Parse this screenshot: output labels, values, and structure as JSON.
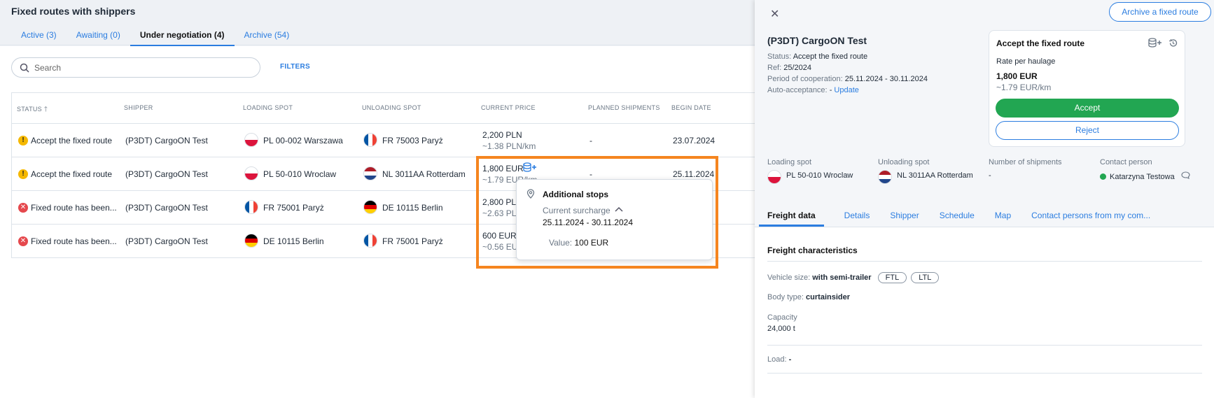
{
  "header": {
    "title": "Fixed routes with shippers",
    "tabs": [
      {
        "label": "Active (3)"
      },
      {
        "label": "Awaiting (0)"
      },
      {
        "label": "Under negotiation (4)"
      },
      {
        "label": "Archive (54)"
      }
    ]
  },
  "toolbar": {
    "search_placeholder": "Search",
    "filters_label": "FILTERS"
  },
  "table": {
    "columns": [
      "STATUS",
      "SHIPPER",
      "LOADING SPOT",
      "UNLOADING SPOT",
      "CURRENT PRICE",
      "PLANNED SHIPMENTS",
      "BEGIN DATE"
    ],
    "rows": [
      {
        "status": "Accept the fixed route",
        "status_type": "warning",
        "shipper": "(P3DT) CargoON Test",
        "loading": "PL 00-002 Warszawa",
        "loading_flag": "PL",
        "unloading": "FR 75003 Paryż",
        "unloading_flag": "FR",
        "price": "2,200 PLN",
        "price_km": "~1.38 PLN/km",
        "planned": "-",
        "begin": "23.07.2024"
      },
      {
        "status": "Accept the fixed route",
        "status_type": "warning",
        "shipper": "(P3DT) CargoON Test",
        "loading": "PL 50-010 Wroclaw",
        "loading_flag": "PL",
        "unloading": "NL 3011AA Rotterdam",
        "unloading_flag": "NL",
        "price": "1,800 EUR",
        "price_km": "~1.79 EUR/km",
        "planned": "-",
        "begin": "25.11.2024"
      },
      {
        "status": "Fixed route has been...",
        "status_type": "error",
        "shipper": "(P3DT) CargoON Test",
        "loading": "FR 75001 Paryż",
        "loading_flag": "FR",
        "unloading": "DE 10115 Berlin",
        "unloading_flag": "DE",
        "price": "2,800 PLN",
        "price_km": "~2.63 PLN/km",
        "planned": "",
        "begin": ""
      },
      {
        "status": "Fixed route has been...",
        "status_type": "error",
        "shipper": "(P3DT) CargoON Test",
        "loading": "DE 10115 Berlin",
        "loading_flag": "DE",
        "unloading": "FR 75001 Paryż",
        "unloading_flag": "FR",
        "price": "600 EUR",
        "price_km": "~0.56 EUR/km",
        "planned": "",
        "begin": ""
      }
    ]
  },
  "popup": {
    "title": "Additional stops",
    "surcharge_label": "Current surcharge",
    "dates": "25.11.2024 - 30.11.2024",
    "value_label": "Value:",
    "value": "100 EUR"
  },
  "detail": {
    "archive_button": "Archive a fixed route",
    "title": "(P3DT) CargoON Test",
    "status_label": "Status:",
    "status_value": "Accept the fixed route",
    "ref_label": "Ref:",
    "ref_value": "25/2024",
    "period_label": "Period of cooperation:",
    "period_value": "25.11.2024 - 30.11.2024",
    "auto_label": "Auto-acceptance:",
    "auto_value": "-",
    "auto_link": "Update",
    "accept_card": {
      "title": "Accept the fixed route",
      "rate_label": "Rate per haulage",
      "price": "1,800 EUR",
      "price_km": "~1.79 EUR/km",
      "accept_label": "Accept",
      "reject_label": "Reject"
    },
    "spots": {
      "loading_label": "Loading spot",
      "loading_value": "PL 50-010 Wroclaw",
      "unloading_label": "Unloading spot",
      "unloading_value": "NL 3011AA Rotterdam",
      "shipments_label": "Number of shipments",
      "shipments_value": "-",
      "contact_label": "Contact person",
      "contact_value": "Katarzyna Testowa"
    },
    "tabs": [
      {
        "label": "Freight data"
      },
      {
        "label": "Details"
      },
      {
        "label": "Shipper"
      },
      {
        "label": "Schedule"
      },
      {
        "label": "Map"
      },
      {
        "label": "Contact persons from my com..."
      }
    ],
    "freight": {
      "title": "Freight characteristics",
      "vehicle_label": "Vehicle size:",
      "vehicle_value": "with semi-trailer",
      "chip_ftl": "FTL",
      "chip_ltl": "LTL",
      "body_label": "Body type:",
      "body_value": "curtainsider",
      "capacity_label": "Capacity",
      "capacity_value": "24,000 t",
      "load_label": "Load:",
      "load_value": "-"
    }
  }
}
